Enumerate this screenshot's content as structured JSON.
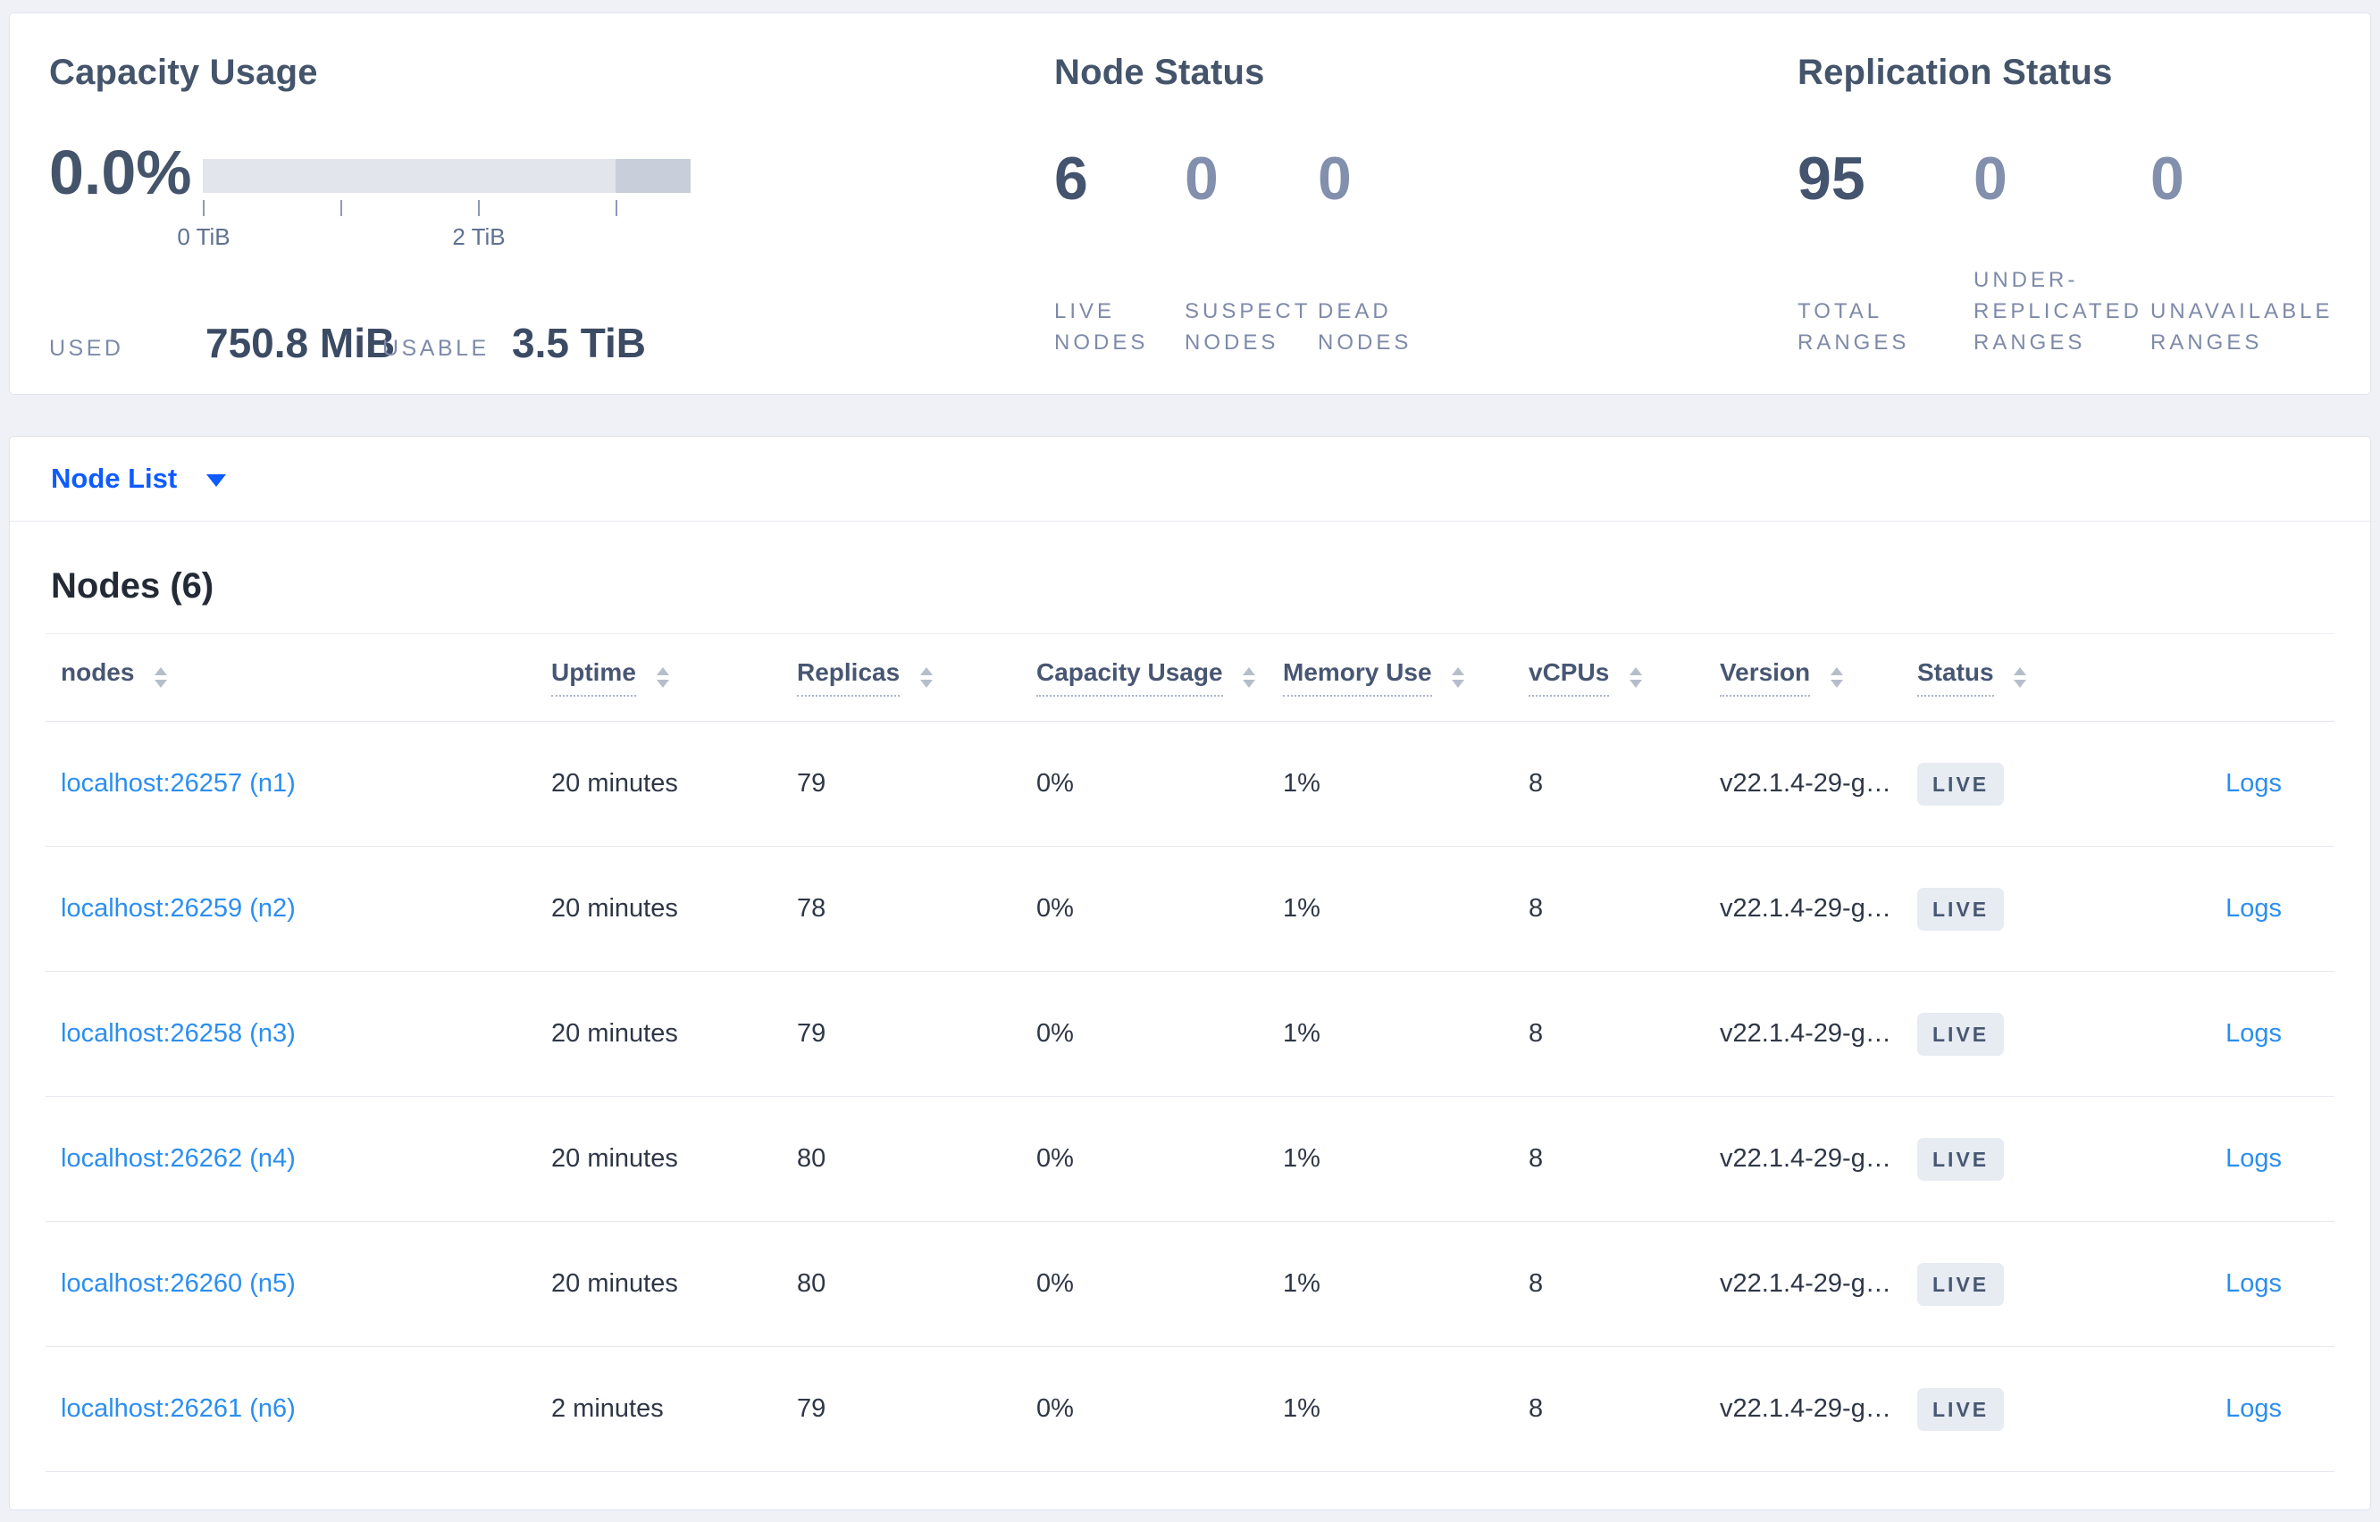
{
  "summary": {
    "capacity": {
      "title": "Capacity Usage",
      "percent": "0.0%",
      "tick_label_0": "0 TiB",
      "tick_label_2": "2 TiB",
      "used_label": "USED",
      "used_value": "750.8 MiB",
      "usable_label": "USABLE",
      "usable_value": "3.5 TiB"
    },
    "node_status": {
      "title": "Node Status",
      "metrics": [
        {
          "value": "6",
          "label": "LIVE\nNODES"
        },
        {
          "value": "0",
          "label": "SUSPECT\nNODES"
        },
        {
          "value": "0",
          "label": "DEAD\nNODES"
        }
      ]
    },
    "replication": {
      "title": "Replication Status",
      "metrics": [
        {
          "value": "95",
          "label": "TOTAL\nRANGES"
        },
        {
          "value": "0",
          "label": "UNDER-\nREPLICATED\nRANGES"
        },
        {
          "value": "0",
          "label": "UNAVAILABLE\nRANGES"
        }
      ]
    }
  },
  "node_list": {
    "dropdown_label": "Node List",
    "heading": "Nodes (6)",
    "columns": [
      {
        "label": "nodes"
      },
      {
        "label": "Uptime"
      },
      {
        "label": "Replicas"
      },
      {
        "label": "Capacity Usage"
      },
      {
        "label": "Memory Use"
      },
      {
        "label": "vCPUs"
      },
      {
        "label": "Version"
      },
      {
        "label": "Status"
      }
    ],
    "rows": [
      {
        "node": "localhost:26257 (n1)",
        "uptime": "20 minutes",
        "replicas": "79",
        "capacity": "0%",
        "memory": "1%",
        "vcpus": "8",
        "version": "v22.1.4-29-g…",
        "status": "LIVE",
        "logs": "Logs"
      },
      {
        "node": "localhost:26259 (n2)",
        "uptime": "20 minutes",
        "replicas": "78",
        "capacity": "0%",
        "memory": "1%",
        "vcpus": "8",
        "version": "v22.1.4-29-g…",
        "status": "LIVE",
        "logs": "Logs"
      },
      {
        "node": "localhost:26258 (n3)",
        "uptime": "20 minutes",
        "replicas": "79",
        "capacity": "0%",
        "memory": "1%",
        "vcpus": "8",
        "version": "v22.1.4-29-g…",
        "status": "LIVE",
        "logs": "Logs"
      },
      {
        "node": "localhost:26262 (n4)",
        "uptime": "20 minutes",
        "replicas": "80",
        "capacity": "0%",
        "memory": "1%",
        "vcpus": "8",
        "version": "v22.1.4-29-g…",
        "status": "LIVE",
        "logs": "Logs"
      },
      {
        "node": "localhost:26260 (n5)",
        "uptime": "20 minutes",
        "replicas": "80",
        "capacity": "0%",
        "memory": "1%",
        "vcpus": "8",
        "version": "v22.1.4-29-g…",
        "status": "LIVE",
        "logs": "Logs"
      },
      {
        "node": "localhost:26261 (n6)",
        "uptime": "2 minutes",
        "replicas": "79",
        "capacity": "0%",
        "memory": "1%",
        "vcpus": "8",
        "version": "v22.1.4-29-g…",
        "status": "LIVE",
        "logs": "Logs"
      }
    ]
  },
  "colors": {
    "accent_blue": "#0e5bff",
    "link_blue": "#2b8ef0",
    "dark_slate": "#44546b",
    "muted_slate": "#7e8aa8",
    "badge_bg": "#e7ebf2",
    "bar_light": "#e3e5ec",
    "bar_dark": "#c9cedb",
    "page_bg": "#eff1f6"
  }
}
